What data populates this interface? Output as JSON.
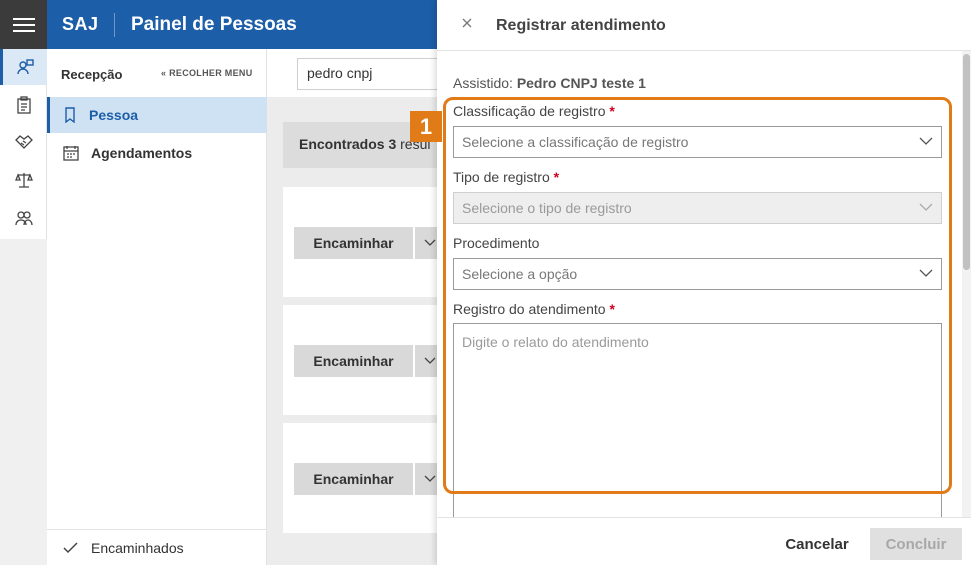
{
  "header": {
    "brand": "SAJ",
    "title": "Painel de Pessoas"
  },
  "sidebar": {
    "heading": "Recepção",
    "collapse_label": "« RECOLHER MENU",
    "items": [
      {
        "label": "Pessoa",
        "icon": "bookmark-icon",
        "active": true
      },
      {
        "label": "Agendamentos",
        "icon": "calendar-icon",
        "active": false
      }
    ],
    "footer_item": {
      "label": "Encaminhados",
      "icon": "check-icon"
    }
  },
  "rail": {
    "icons": [
      "person-badge-icon",
      "clipboard-icon",
      "handshake-icon",
      "scales-icon",
      "people-icon"
    ]
  },
  "main": {
    "search_value": "pedro cnpj",
    "results_text": "Encontrados 3",
    "results_suffix": "resul",
    "cards": [
      {
        "button_label": "Encaminhar"
      },
      {
        "button_label": "Encaminhar"
      },
      {
        "button_label": "Encaminhar"
      }
    ]
  },
  "panel": {
    "title": "Registrar atendimento",
    "assistido_label": "Assistido:",
    "assistido_value": "Pedro CNPJ teste 1",
    "fields": {
      "classificacao": {
        "label": "Classificação de registro",
        "required": "*",
        "placeholder": "Selecione a classificação de registro"
      },
      "tipo": {
        "label": "Tipo de registro",
        "required": "*",
        "placeholder": "Selecione o tipo de registro"
      },
      "procedimento": {
        "label": "Procedimento",
        "placeholder": "Selecione a opção"
      },
      "registro": {
        "label": "Registro do atendimento",
        "required": "*",
        "placeholder": "Digite o relato do atendimento"
      }
    },
    "cancel_label": "Cancelar",
    "conclude_label": "Concluir"
  },
  "annotation": {
    "marker": "1",
    "color": "#e07b17"
  },
  "colors": {
    "brand": "#1c5ea8",
    "required": "#d0021b"
  }
}
